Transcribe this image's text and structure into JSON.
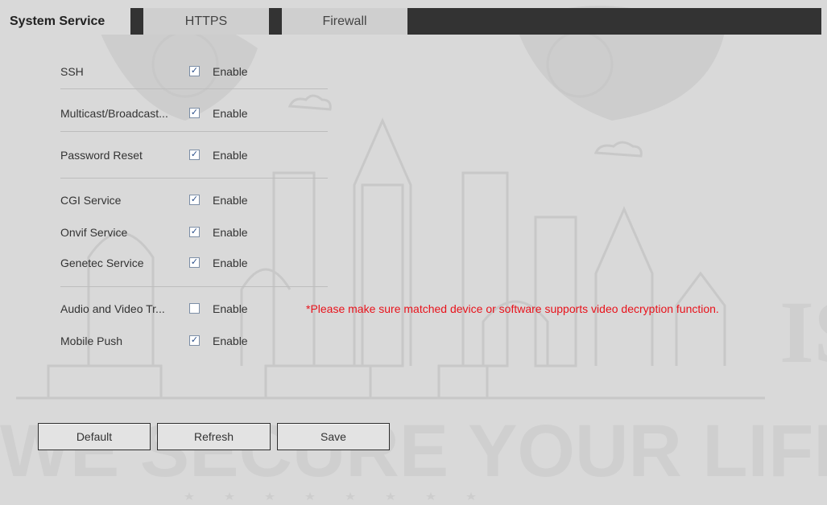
{
  "tabs": [
    {
      "label": "System Service"
    },
    {
      "label": "HTTPS"
    },
    {
      "label": "Firewall"
    }
  ],
  "services": [
    {
      "label": "SSH",
      "checked": true,
      "option": "Enable"
    },
    {
      "label": "Multicast/Broadcast...",
      "checked": true,
      "option": "Enable"
    },
    {
      "label": "Password Reset",
      "checked": true,
      "option": "Enable"
    },
    {
      "label": "CGI Service",
      "checked": true,
      "option": "Enable"
    },
    {
      "label": "Onvif Service",
      "checked": true,
      "option": "Enable"
    },
    {
      "label": "Genetec Service",
      "checked": true,
      "option": "Enable"
    },
    {
      "label": "Audio and Video Tr...",
      "checked": false,
      "option": "Enable"
    },
    {
      "label": "Mobile Push",
      "checked": true,
      "option": "Enable"
    }
  ],
  "warning": "*Please make sure matched device or software supports video decryption function.",
  "buttons": {
    "default": "Default",
    "refresh": "Refresh",
    "save": "Save"
  },
  "watermark": {
    "slogan": "WE SECURE YOUR LIFE",
    "edge_text": "IS"
  },
  "check_glyph": "✓",
  "colors": {
    "background": "#d9d9d9",
    "tab_bar": "#333333",
    "warning": "#e8121b"
  }
}
